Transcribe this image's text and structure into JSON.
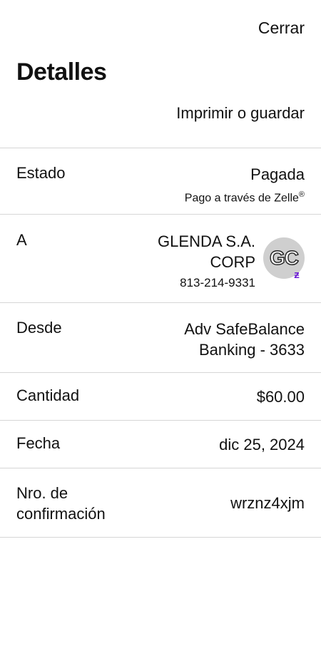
{
  "header": {
    "close_label": "Cerrar",
    "title": "Detalles",
    "print_label": "Imprimir o guardar"
  },
  "status": {
    "label": "Estado",
    "value": "Pagada",
    "sub": "Pago a través de Zelle",
    "sub_mark": "®"
  },
  "recipient": {
    "label": "A",
    "name_line1": "GLENDA S.A.",
    "name_line2": "CORP",
    "phone": "813-214-9331",
    "avatar_initials": "GC",
    "avatar_badge_icon": "zelle-z-icon",
    "avatar_bg": "#cfcfcf",
    "badge_color": "#6d1ed4"
  },
  "from": {
    "label": "Desde",
    "value_line1": "Adv SafeBalance",
    "value_line2": "Banking - 3633"
  },
  "amount": {
    "label": "Cantidad",
    "value": "$60.00"
  },
  "date": {
    "label": "Fecha",
    "value": "dic 25, 2024"
  },
  "confirmation": {
    "label_line1": "Nro. de",
    "label_line2": "confirmación",
    "value": "wrznz4xjm"
  }
}
